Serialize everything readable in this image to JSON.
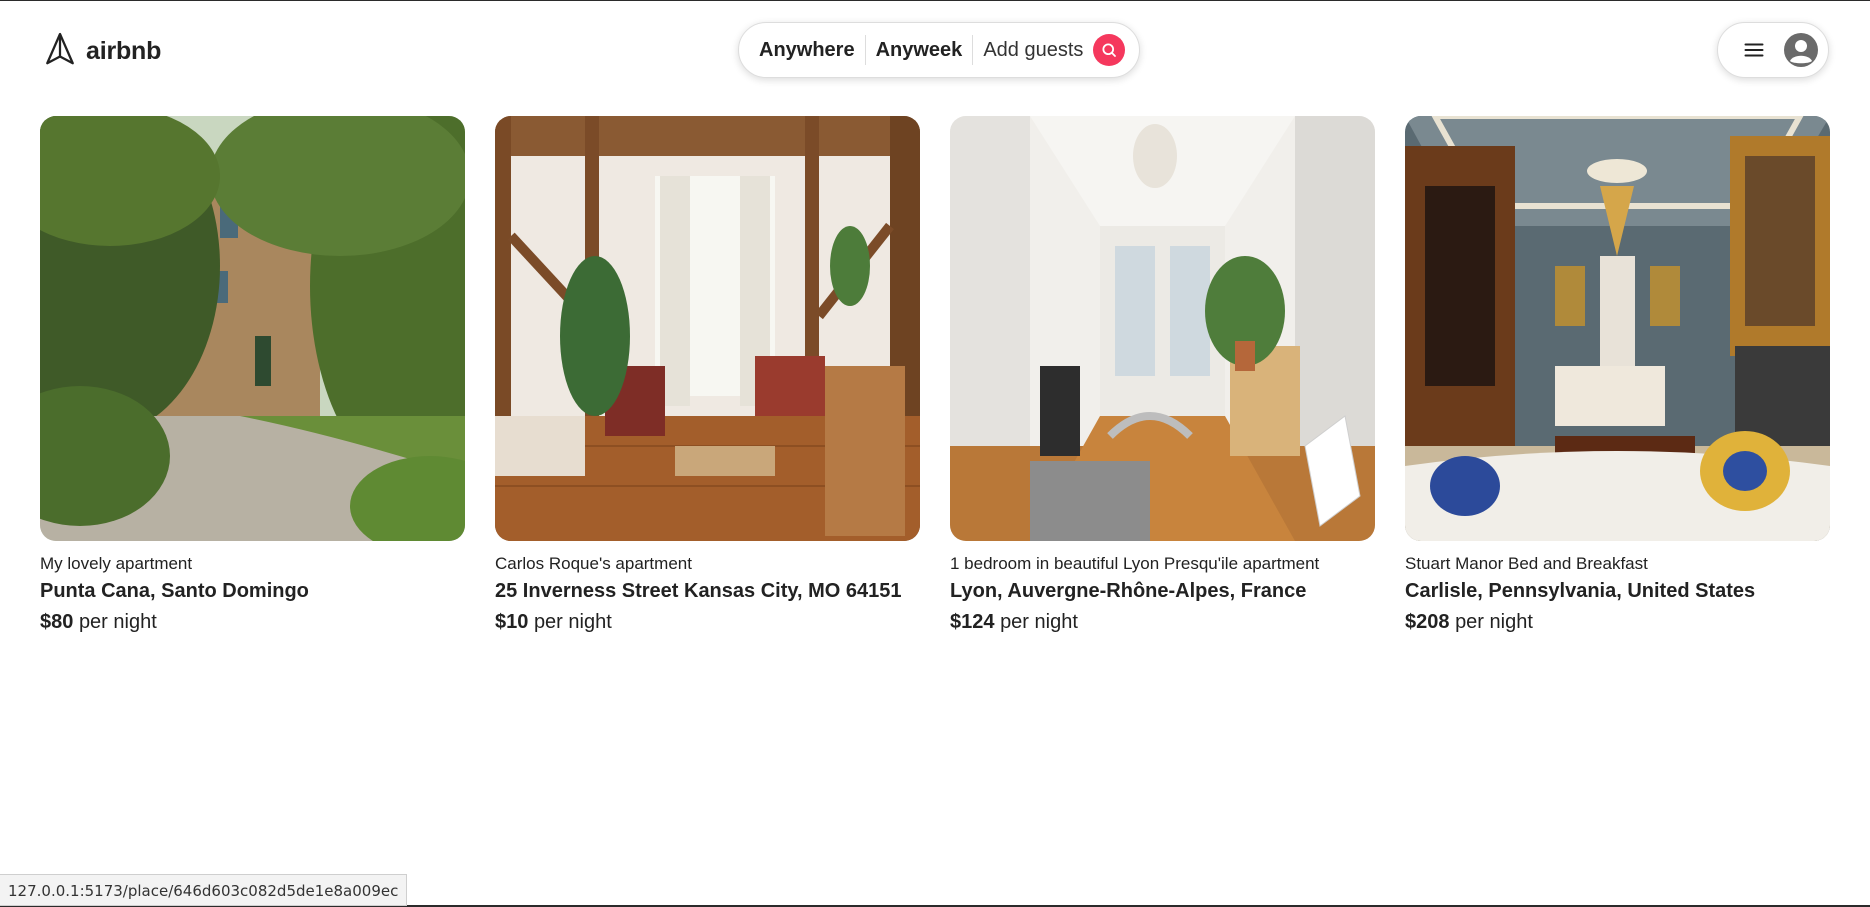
{
  "brand": {
    "name": "airbnb",
    "logo_icon": "paper-plane-icon",
    "accent_color": "#f5385d"
  },
  "search": {
    "anywhere_label": "Anywhere",
    "anyweek_label": "Anyweek",
    "guests_label": "Add guests",
    "search_icon": "search-icon"
  },
  "user_menu": {
    "menu_icon": "hamburger-icon",
    "avatar_icon": "user-avatar-icon"
  },
  "listings": [
    {
      "title": "My lovely apartment",
      "address": "Punta Cana, Santo Domingo",
      "price": "$80",
      "price_suffix": "per night"
    },
    {
      "title": "Carlos Roque's apartment",
      "address": "25 Inverness Street Kansas City, MO 64151",
      "price": "$10",
      "price_suffix": "per night"
    },
    {
      "title": "1 bedroom in beautiful Lyon Presqu'ile apartment",
      "address": "Lyon, Auvergne-Rhône-Alpes, France",
      "price": "$124",
      "price_suffix": "per night"
    },
    {
      "title": "Stuart Manor Bed and Breakfast",
      "address": "Carlisle, Pennsylvania, United States",
      "price": "$208",
      "price_suffix": "per night"
    }
  ],
  "status_bar": {
    "url": "127.0.0.1:5173/place/646d603c082d5de1e8a009ec"
  }
}
